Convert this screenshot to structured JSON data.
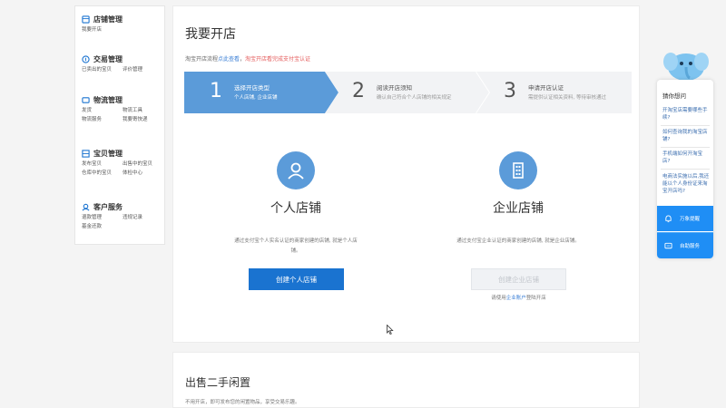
{
  "sidebar": {
    "sections": [
      {
        "title": "店铺管理",
        "links": [
          "我要开店"
        ]
      },
      {
        "title": "交易管理",
        "links": [
          "已卖出的宝贝",
          "评价管理"
        ]
      },
      {
        "title": "物流管理",
        "links": [
          "发货",
          "物流工具",
          "物流服务",
          "我要寄快递"
        ]
      },
      {
        "title": "宝贝管理",
        "links": [
          "发布宝贝",
          "出售中的宝贝",
          "仓库中的宝贝",
          "体检中心"
        ]
      },
      {
        "title": "客户服务",
        "links": [
          "退款管理",
          "违规记录",
          "基金还款"
        ]
      }
    ]
  },
  "main": {
    "title": "我要开店",
    "note": {
      "prefix": "淘宝开店流程",
      "link1": "点此查看",
      "sep": "，",
      "link2": "淘宝开店看完成支付宝认证"
    },
    "steps": [
      {
        "num": "1",
        "title": "选择开店类型",
        "sub": "个人店铺, 企业店铺"
      },
      {
        "num": "2",
        "title": "阅读开店须知",
        "sub": "确认自己符合个人店铺的相关规定"
      },
      {
        "num": "3",
        "title": "申请开店认证",
        "sub": "需提供认证相关资料, 等待审核通过"
      }
    ],
    "personal": {
      "name": "个人店铺",
      "desc": "通过支付宝个人实名认证的商家创建的店铺, 就是个人店铺。",
      "button": "创建个人店铺"
    },
    "enterprise": {
      "name": "企业店铺",
      "desc": "通过支付宝企业认证的商家创建的店铺, 就是企业店铺。",
      "button": "创建企业店铺",
      "hint_prefix": "请使用",
      "hint_link": "企业账户",
      "hint_suffix": "登陆开店"
    }
  },
  "second_card": {
    "title": "出售二手闲置",
    "desc": "不用开店，即可发布您的闲置物品，享受交易乐趣。"
  },
  "assistant": {
    "title": "猜你想问",
    "questions": [
      "开淘宝店需要哪些手续?",
      "如何查询我的淘宝店铺?",
      "手机端如何开淘宝店?",
      "电商法实施以后,我还能以个人身份证来淘宝开店吗?"
    ],
    "buttons": [
      "万象提醒",
      "自助服务"
    ]
  },
  "colors": {
    "accent": "#1a73d0",
    "step_active": "#5b9bd9",
    "step_idle": "#f2f3f5",
    "icon_blue": "#5b9bd9"
  }
}
